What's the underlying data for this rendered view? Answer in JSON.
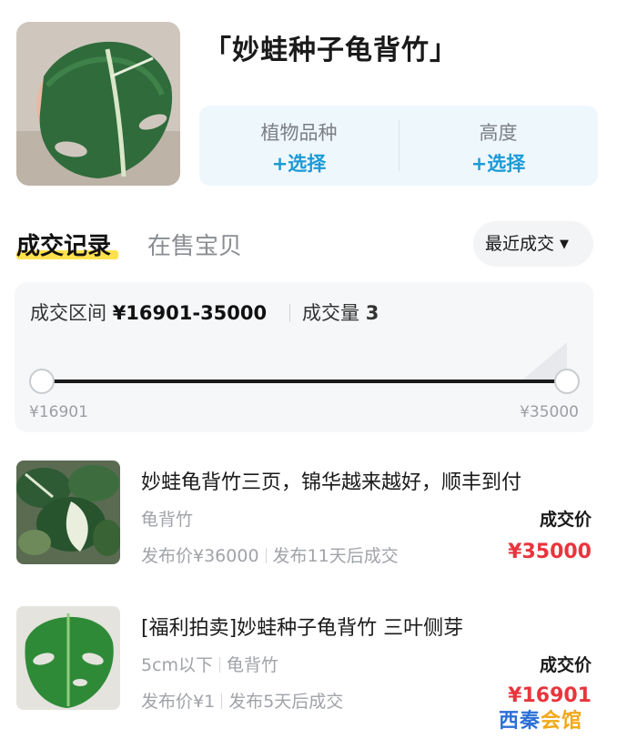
{
  "header": {
    "title": "「妙蛙种子龟背竹」",
    "image_icon": "monstera-leaf-photo",
    "specs": [
      {
        "label": "植物品种",
        "action": "+选择"
      },
      {
        "label": "高度",
        "action": "+选择"
      }
    ]
  },
  "tabs": {
    "active": "成交记录",
    "inactive": "在售宝贝"
  },
  "sort": {
    "label": "最近成交",
    "icon": "caret-down-icon"
  },
  "range": {
    "label": "成交区间",
    "value": "¥16901-35000",
    "volume_label": "成交量",
    "volume_value": "3",
    "min_label": "¥16901",
    "max_label": "¥35000",
    "min_fraction": 0,
    "max_fraction": 1
  },
  "listings": [
    {
      "title": "妙蛙龟背竹三页，锦华越来越好，顺丰到付",
      "tags": [
        "龟背竹"
      ],
      "publish_price": "发布价¥36000",
      "publish_time": "发布11天后成交",
      "deal_label": "成交价",
      "deal_price": "¥35000",
      "image_icon": "variegated-monstera-photo"
    },
    {
      "title": "[福利拍卖]妙蛙种子龟背竹 三叶侧芽",
      "tags": [
        "5cm以下",
        "龟背竹"
      ],
      "publish_price": "发布价¥1",
      "publish_time": "发布5天后成交",
      "deal_label": "成交价",
      "deal_price": "¥16901",
      "image_icon": "monstera-leaf-photo"
    }
  ],
  "watermark": {
    "text_a": "西秦",
    "text_b": "会馆",
    "color_a": "#2b6fd6",
    "color_b": "#f2a818"
  },
  "colors": {
    "accent_blue": "#1b9ad6",
    "price_red": "#e8353d",
    "tab_underline": "#ffe14d"
  }
}
